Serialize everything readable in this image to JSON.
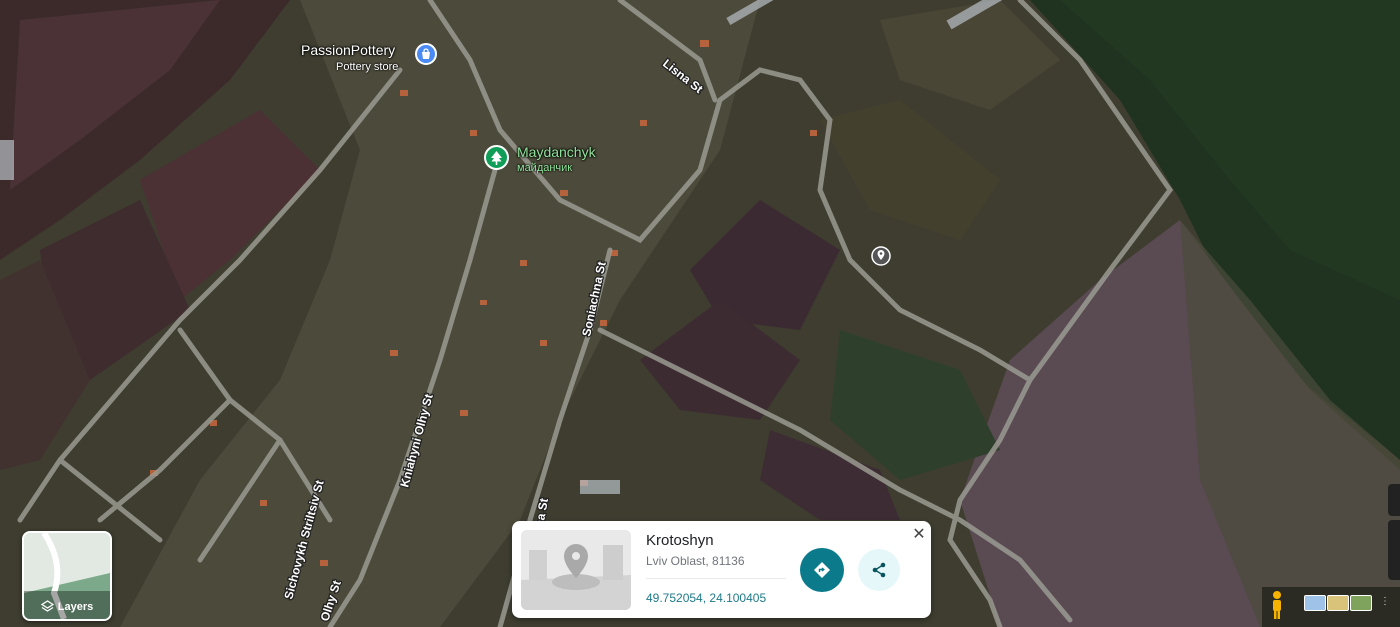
{
  "map": {
    "roads": [
      "Lisna St",
      "Soniachna St",
      "Kniahyni Olhy St",
      "Olhy St",
      "Sichovykh Striltsiv St",
      "na St"
    ]
  },
  "places": {
    "pottery": {
      "title": "PassionPottery",
      "subtitle": "Pottery store",
      "icon": "lock-shop-icon"
    },
    "park": {
      "title": "Maydanchyk",
      "subtitle": "майданчик",
      "icon": "tree-icon"
    },
    "marker": {
      "icon": "location-pin-icon"
    }
  },
  "layers": {
    "label": "Layers"
  },
  "info_card": {
    "title": "Krotoshyn",
    "subtitle": "Lviv Oblast, 81136",
    "coordinates": "49.752054, 24.100405",
    "directions_icon": "directions-icon",
    "share_icon": "share-icon",
    "close_icon": "close-icon",
    "close_label": "✕"
  },
  "colors": {
    "accent": "#0b7b8c",
    "road": "#9a9a92",
    "park_pin": "#0f9d58",
    "shop_pin": "#4a8af4"
  }
}
